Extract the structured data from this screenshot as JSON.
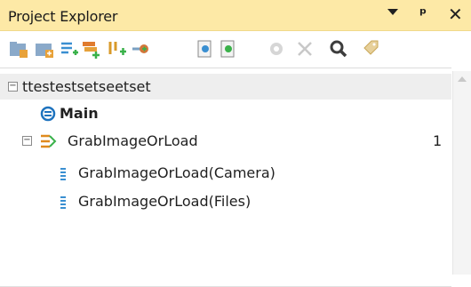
{
  "panel": {
    "title": "Project Explorer",
    "controls": [
      "dropdown-icon",
      "pin-icon",
      "close-icon"
    ]
  },
  "toolbar": {
    "icons": [
      "new-folder-icon",
      "add-item-icon",
      "add-list-icon",
      "add-group-icon",
      "branch-icon",
      "merge-icon",
      "copy-doc-icon",
      "paste-doc-icon",
      "settings-icon",
      "delete-icon",
      "search-icon",
      "tag-icon"
    ]
  },
  "tree": {
    "root": {
      "label": "ttestestsetseetset",
      "expanded": true
    },
    "main": {
      "label": "Main"
    },
    "group": {
      "label": "GrabImageOrLoad",
      "count": "1",
      "expanded": true
    },
    "children": [
      {
        "label": "GrabImageOrLoad(Camera)"
      },
      {
        "label": "GrabImageOrLoad(Files)"
      }
    ]
  },
  "colors": {
    "titlebar": "#fde9a6",
    "selected_row": "#eeeeee",
    "icon_blue": "#1e73be",
    "icon_orange": "#e08a1e"
  }
}
